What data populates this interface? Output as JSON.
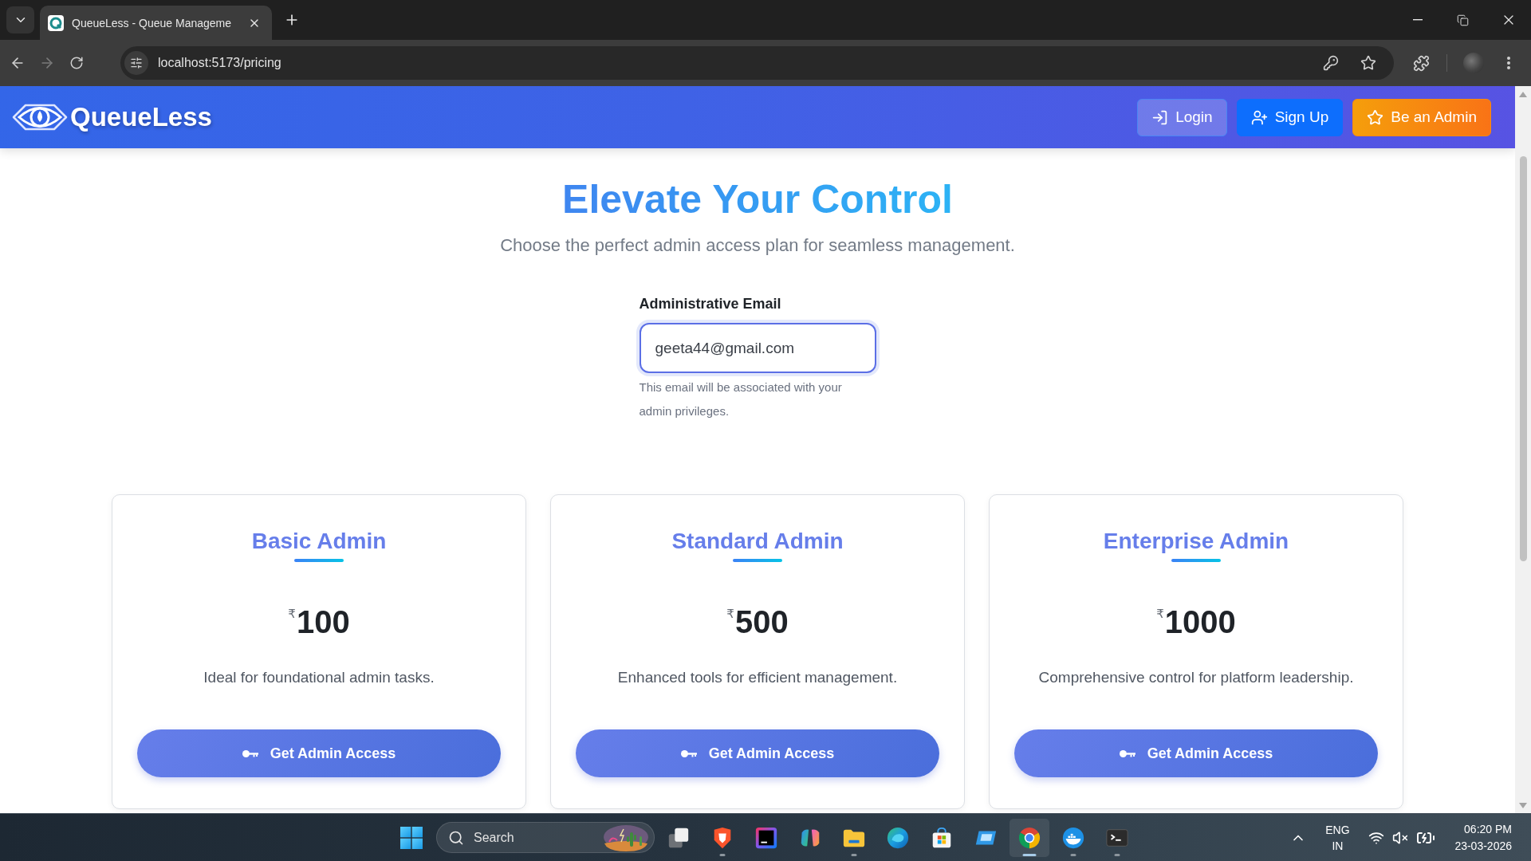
{
  "browser": {
    "tab": {
      "title": "QueueLess - Queue Manageme"
    },
    "nav_buttons": [
      {
        "kind": "back",
        "disabled": false
      },
      {
        "kind": "forward",
        "disabled": true
      },
      {
        "kind": "reload",
        "disabled": false
      }
    ],
    "url": "localhost:5173/pricing"
  },
  "navbar": {
    "brand": "QueueLess",
    "buttons": [
      {
        "kind": "login",
        "label": "Login"
      },
      {
        "kind": "signup",
        "label": "Sign Up"
      },
      {
        "kind": "admin",
        "label": "Be an Admin"
      }
    ]
  },
  "hero": {
    "title": "Elevate Your Control",
    "subtitle": "Choose the perfect admin access plan for seamless management."
  },
  "email_form": {
    "label": "Administrative Email",
    "value": "geeta44@gmail.com",
    "focused": true,
    "help": "This email will be associated with your admin privileges."
  },
  "plans": [
    {
      "name": "Basic Admin",
      "currency": "₹",
      "price": "100",
      "description": "Ideal for foundational admin tasks.",
      "button": "Get Admin Access"
    },
    {
      "name": "Standard Admin",
      "currency": "₹",
      "price": "500",
      "description": "Enhanced tools for efficient management.",
      "button": "Get Admin Access"
    },
    {
      "name": "Enterprise Admin",
      "currency": "₹",
      "price": "1000",
      "description": "Comprehensive control for platform leadership.",
      "button": "Get Admin Access"
    }
  ],
  "taskbar": {
    "search": {
      "placeholder": "Search"
    },
    "apps": [
      {
        "kind": "taskview",
        "running": false,
        "selected": false
      },
      {
        "kind": "brave",
        "running": true,
        "selected": false
      },
      {
        "kind": "intellij",
        "running": false,
        "selected": false
      },
      {
        "kind": "copilot",
        "running": false,
        "selected": false
      },
      {
        "kind": "explorer",
        "running": true,
        "selected": false
      },
      {
        "kind": "edge",
        "running": false,
        "selected": false
      },
      {
        "kind": "store",
        "running": false,
        "selected": false
      },
      {
        "kind": "remote",
        "running": false,
        "selected": false
      },
      {
        "kind": "chrome",
        "running": true,
        "selected": true
      },
      {
        "kind": "docker",
        "running": true,
        "selected": false
      },
      {
        "kind": "terminal",
        "running": true,
        "selected": false
      }
    ],
    "tray": {
      "language": "ENG",
      "region": "IN",
      "muted": true,
      "charging": true,
      "time": "06:20 PM",
      "date": "23-03-2026"
    }
  }
}
